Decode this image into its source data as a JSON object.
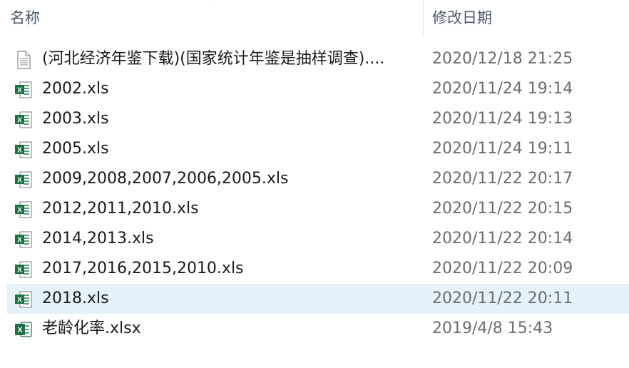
{
  "header": {
    "name_label": "名称",
    "date_label": "修改日期",
    "sort_indicator": "⌃"
  },
  "files": [
    {
      "name": "(河北经济年鉴下载)(国家统计年鉴是抽样调查)....",
      "date": "2020/12/18 21:25",
      "icon": "text-file-icon"
    },
    {
      "name": "2002.xls",
      "date": "2020/11/24 19:14",
      "icon": "excel-xls-icon"
    },
    {
      "name": "2003.xls",
      "date": "2020/11/24 19:13",
      "icon": "excel-xls-icon"
    },
    {
      "name": "2005.xls",
      "date": "2020/11/24 19:11",
      "icon": "excel-xls-icon"
    },
    {
      "name": "2009,2008,2007,2006,2005.xls",
      "date": "2020/11/22 20:17",
      "icon": "excel-xls-icon"
    },
    {
      "name": "2012,2011,2010.xls",
      "date": "2020/11/22 20:15",
      "icon": "excel-xls-icon"
    },
    {
      "name": "2014,2013.xls",
      "date": "2020/11/22 20:14",
      "icon": "excel-xls-icon"
    },
    {
      "name": "2017,2016,2015,2010.xls",
      "date": "2020/11/22 20:09",
      "icon": "excel-xls-icon"
    },
    {
      "name": "2018.xls",
      "date": "2020/11/22 20:11",
      "icon": "excel-xls-icon",
      "selected": true
    },
    {
      "name": "老龄化率.xlsx",
      "date": "2019/4/8 15:43",
      "icon": "excel-xlsx-icon"
    }
  ],
  "colors": {
    "selection": "#e5f1fb",
    "excel_green": "#1d7044",
    "header_text": "#4a5a6f",
    "date_text": "#6d6d6d"
  }
}
